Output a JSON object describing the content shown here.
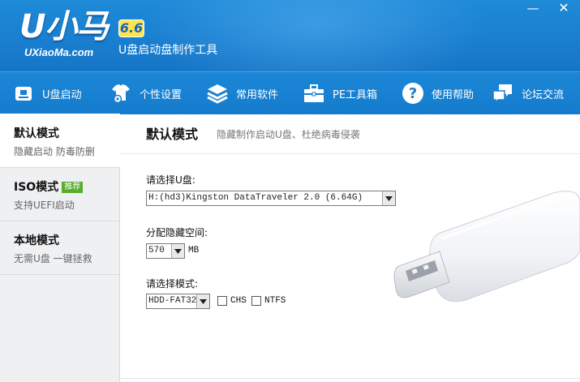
{
  "app": {
    "logo_text": "U小马",
    "version": "6.6",
    "site": "UXiaoMa.com",
    "tagline": "U盘启动盘制作工具"
  },
  "window_controls": {
    "minimize": "—",
    "close": "✕"
  },
  "nav": [
    {
      "label": "U盘启动",
      "icon": "usb-drive-icon"
    },
    {
      "label": "个性设置",
      "icon": "shirt-gear-icon"
    },
    {
      "label": "常用软件",
      "icon": "layers-icon"
    },
    {
      "label": "PE工具箱",
      "icon": "toolbox-icon"
    },
    {
      "label": "使用帮助",
      "icon": "help-icon"
    },
    {
      "label": "论坛交流",
      "icon": "chat-bubbles-icon"
    }
  ],
  "sidebar": {
    "items": [
      {
        "title": "默认模式",
        "sub": "隐藏启动 防毒防删",
        "badge": ""
      },
      {
        "title": "ISO模式",
        "sub": "支持UEFI启动",
        "badge": "推荐"
      },
      {
        "title": "本地模式",
        "sub": "无需U盘 一键拯救",
        "badge": ""
      }
    ],
    "active_index": 0
  },
  "main": {
    "title": "默认模式",
    "subtitle": "隐藏制作启动U盘、杜绝病毒侵袭",
    "disk_label": "请选择U盘:",
    "disk_value": "H:(hd3)Kingston DataTraveler 2.0 (6.64G)",
    "space_label": "分配隐藏空间:",
    "space_value": "570",
    "space_unit": "MB",
    "mode_label": "请选择模式:",
    "mode_value": "HDD-FAT32",
    "opt_chs": "CHS",
    "opt_ntfs": "NTFS",
    "opt_chs_checked": false,
    "opt_ntfs_checked": false
  },
  "colors": {
    "header_blue": "#1a7fd0",
    "nav_blue": "#157ccd",
    "badge_green": "#55ad2a",
    "version_yellow": "#ffe44d"
  }
}
